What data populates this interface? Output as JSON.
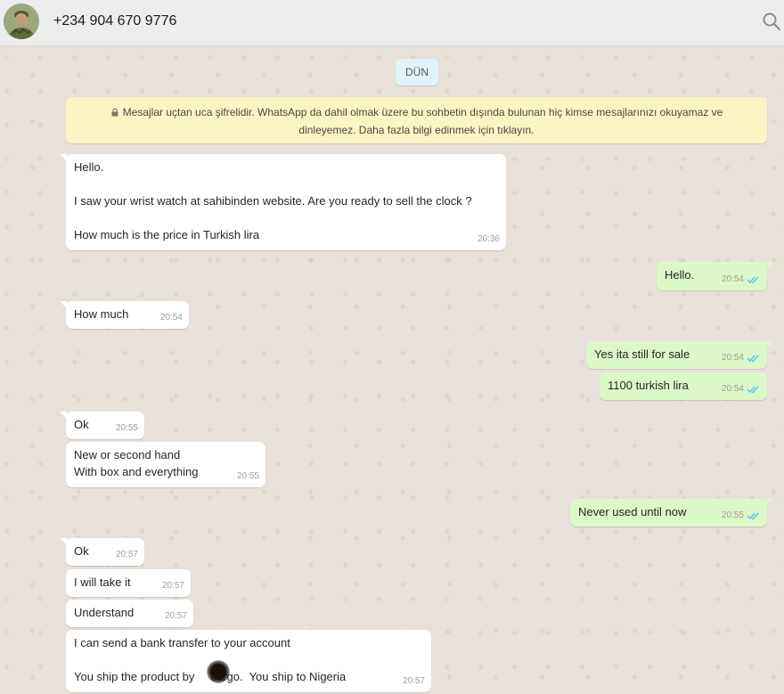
{
  "header": {
    "contact_name": "+234 904 670 9776",
    "search_icon": "search-icon",
    "avatar_icon": "contact-avatar"
  },
  "chat": {
    "date_label": "DÜN",
    "encryption_notice": "Mesajlar uçtan uca şifrelidir. WhatsApp da dahil olmak üzere bu sohbetin dışında bulunan hiç kimse mesajlarınızı okuyamaz ve dinleyemez. Daha fazla bilgi edinmek için tıklayın.",
    "lock_icon": "lock-icon",
    "messages": [
      {
        "direction": "in",
        "text": "Hello.\n\nI saw your wrist watch at sahibinden website. Are you ready to sell the clock ?\n\nHow much is the price in Turkish lira",
        "time": "20:36"
      },
      {
        "direction": "out",
        "text": "Hello.",
        "time": "20:54",
        "status": "read"
      },
      {
        "direction": "in",
        "text": "How much",
        "time": "20:54"
      },
      {
        "direction": "out",
        "text": "Yes ita still for sale",
        "time": "20:54",
        "status": "read"
      },
      {
        "direction": "out",
        "text": "1100 turkish lira",
        "time": "20:54",
        "status": "read"
      },
      {
        "direction": "in",
        "text": "Ok",
        "time": "20:55"
      },
      {
        "direction": "in",
        "text": "New or second hand\nWith box and everything",
        "time": "20:55"
      },
      {
        "direction": "out",
        "text": "Never used until now",
        "time": "20:55",
        "status": "read"
      },
      {
        "direction": "in",
        "text": "Ok",
        "time": "20:57"
      },
      {
        "direction": "in",
        "text": "I will take it",
        "time": "20:57"
      },
      {
        "direction": "in",
        "text": "Understand",
        "time": "20:57"
      },
      {
        "direction": "in",
        "text": "I can send a bank transfer to your account\n\nYou ship the product by     cargo.  You ship to Nigeria",
        "time": "20:57"
      }
    ]
  },
  "colors": {
    "incoming_bubble": "#ffffff",
    "outgoing_bubble": "#dcf8c6",
    "read_tick": "#4fc3f7",
    "notice_bg": "#fdf4c5",
    "date_chip_bg": "#e1f3fb"
  }
}
